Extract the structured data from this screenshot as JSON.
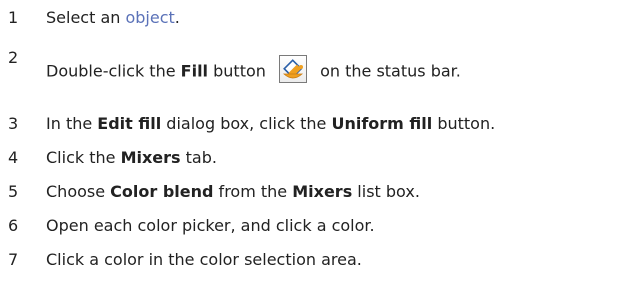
{
  "steps": [
    {
      "number": "1",
      "text_1": "Select an ",
      "link": "object",
      "text_2": "."
    },
    {
      "number": "2",
      "text_1": "Double-click the ",
      "bold_1": "Fill",
      "text_2": " button ",
      "icon": "fill-bucket-icon",
      "text_3": " on the status bar."
    },
    {
      "number": "3",
      "text_1": "In the ",
      "bold_1": "Edit fill",
      "text_2": " dialog box, click the ",
      "bold_2": "Uniform fill",
      "text_3": " button."
    },
    {
      "number": "4",
      "text_1": "Click the ",
      "bold_1": "Mixers",
      "text_2": " tab."
    },
    {
      "number": "5",
      "text_1": "Choose ",
      "bold_1": "Color blend",
      "text_2": " from the ",
      "bold_2": "Mixers",
      "text_3": " list box."
    },
    {
      "number": "6",
      "text_1": "Open each color picker, and click a color."
    },
    {
      "number": "7",
      "text_1": "Click a color in the color selection area."
    }
  ],
  "colors": {
    "text": "#222222",
    "link": "#5b72b8",
    "bucket_fill": "#f0a020",
    "bucket_outline": "#2a5fa8"
  }
}
